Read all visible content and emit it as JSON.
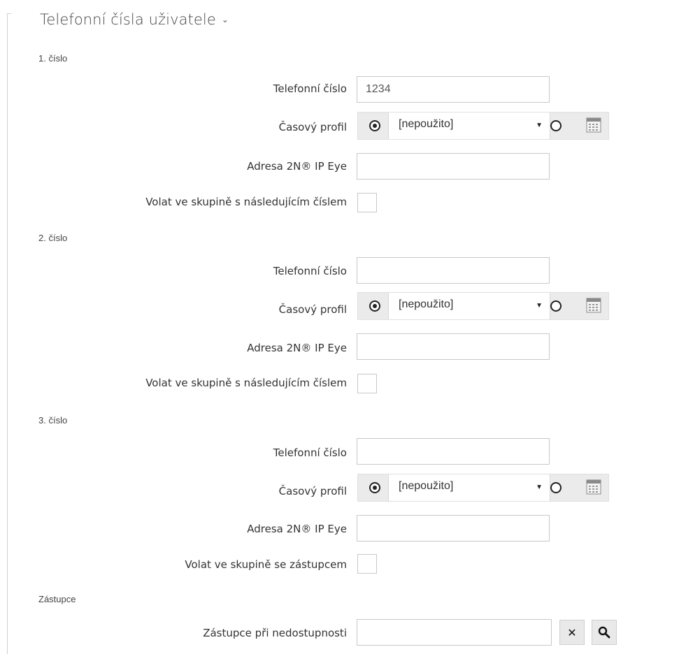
{
  "section": {
    "title": "Telefonní čísla uživatele",
    "chevron": "⌄"
  },
  "numbers": [
    {
      "group_label": "1. číslo",
      "phone_label": "Telefonní číslo",
      "phone_value": "1234",
      "profile_label": "Časový profil",
      "profile_value": "[nepoužito]",
      "eye_label": "Adresa 2N® IP Eye",
      "eye_value": "",
      "group_call_label": "Volat ve skupině s následujícím číslem",
      "group_call_checked": false
    },
    {
      "group_label": "2. číslo",
      "phone_label": "Telefonní číslo",
      "phone_value": "",
      "profile_label": "Časový profil",
      "profile_value": "[nepoužito]",
      "eye_label": "Adresa 2N® IP Eye",
      "eye_value": "",
      "group_call_label": "Volat ve skupině s následujícím číslem",
      "group_call_checked": false
    },
    {
      "group_label": "3. číslo",
      "phone_label": "Telefonní číslo",
      "phone_value": "",
      "profile_label": "Časový profil",
      "profile_value": "[nepoužito]",
      "eye_label": "Adresa 2N® IP Eye",
      "eye_value": "",
      "group_call_label": "Volat ve skupině se zástupcem",
      "group_call_checked": false
    }
  ],
  "deputy": {
    "group_label": "Zástupce",
    "field_label": "Zástupce při nedostupnosti",
    "field_value": "",
    "clear_icon": "close-icon",
    "search_icon": "search-icon",
    "clear_glyph": "✕"
  },
  "icons": {
    "dropdown_caret": "▼"
  }
}
